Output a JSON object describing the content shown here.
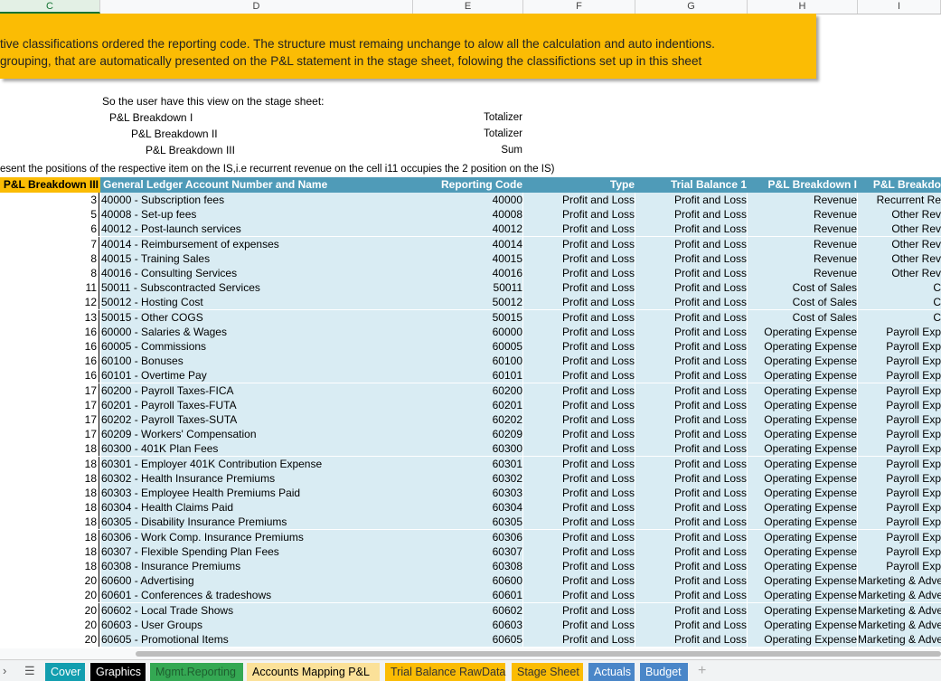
{
  "columns": [
    "C",
    "D",
    "E",
    "F",
    "G",
    "H",
    "I"
  ],
  "banner": {
    "line1": "tive classifications ordered the reporting code. The structure must remaing unchange to alow all the calculation and auto indentions.",
    "line2": " grouping, that are automatically presented on the P&L statement in the stage sheet, folowing the  classifictions set up in this sheet"
  },
  "notes": {
    "intro": "So the user have this view on the stage sheet:",
    "level1": "P&L Breakdown I",
    "level2": "P&L Breakdown II",
    "level3": "P&L Breakdown III",
    "level1_kind": "Totalizer",
    "level2_kind": "Totalizer",
    "level3_kind": "Sum",
    "positions": "esent the positions of the respective item on the IS,i.e recurrent revenue on the cell i11 occupies the 2 position on the IS)"
  },
  "table": {
    "headers": {
      "breakdown3": "P&L Breakdown III",
      "gl": "General Ledger Account Number and Name",
      "reporting_code": "Reporting Code",
      "type": "Type",
      "tb1": "Trial Balance 1",
      "b1": "P&L Breakdown I",
      "b2": "P&L Breakdo"
    },
    "rows": [
      [
        "3",
        "40000 - Subscription fees",
        "40000",
        "Profit and Loss",
        "Profit and Loss",
        "Revenue",
        "Recurrent Re"
      ],
      [
        "5",
        "40008 - Set-up fees",
        "40008",
        "Profit and Loss",
        "Profit and Loss",
        "Revenue",
        "Other Rev"
      ],
      [
        "6",
        "40012 - Post-launch services",
        "40012",
        "Profit and Loss",
        "Profit and Loss",
        "Revenue",
        "Other Rev"
      ],
      [
        "7",
        "40014 - Reimbursement of expenses",
        "40014",
        "Profit and Loss",
        "Profit and Loss",
        "Revenue",
        "Other Rev"
      ],
      [
        "8",
        "40015 - Training Sales",
        "40015",
        "Profit and Loss",
        "Profit and Loss",
        "Revenue",
        "Other Rev"
      ],
      [
        "8",
        "40016 - Consulting Services",
        "40016",
        "Profit and Loss",
        "Profit and Loss",
        "Revenue",
        "Other Rev"
      ],
      [
        "11",
        "50011 - Subscontracted Services",
        "50011",
        "Profit and Loss",
        "Profit and Loss",
        "Cost of Sales",
        "C"
      ],
      [
        "12",
        "50012 - Hosting Cost",
        "50012",
        "Profit and Loss",
        "Profit and Loss",
        "Cost of Sales",
        "C"
      ],
      [
        "13",
        "50015 - Other COGS",
        "50015",
        "Profit and Loss",
        "Profit and Loss",
        "Cost of Sales",
        "C"
      ],
      [
        "16",
        "60000 - Salaries & Wages",
        "60000",
        "Profit and Loss",
        "Profit and Loss",
        "Operating Expense",
        "Payroll Exp"
      ],
      [
        "16",
        "60005 - Commissions",
        "60005",
        "Profit and Loss",
        "Profit and Loss",
        "Operating Expense",
        "Payroll Exp"
      ],
      [
        "16",
        "60100 - Bonuses",
        "60100",
        "Profit and Loss",
        "Profit and Loss",
        "Operating Expense",
        "Payroll Exp"
      ],
      [
        "16",
        "60101 - Overtime Pay",
        "60101",
        "Profit and Loss",
        "Profit and Loss",
        "Operating Expense",
        "Payroll Exp"
      ],
      [
        "17",
        "60200 - Payroll Taxes-FICA",
        "60200",
        "Profit and Loss",
        "Profit and Loss",
        "Operating Expense",
        "Payroll Exp"
      ],
      [
        "17",
        "60201 - Payroll Taxes-FUTA",
        "60201",
        "Profit and Loss",
        "Profit and Loss",
        "Operating Expense",
        "Payroll Exp"
      ],
      [
        "17",
        "60202 - Payroll Taxes-SUTA",
        "60202",
        "Profit and Loss",
        "Profit and Loss",
        "Operating Expense",
        "Payroll Exp"
      ],
      [
        "17",
        "60209 - Workers' Compensation",
        "60209",
        "Profit and Loss",
        "Profit and Loss",
        "Operating Expense",
        "Payroll Exp"
      ],
      [
        "18",
        "60300 - 401K Plan Fees",
        "60300",
        "Profit and Loss",
        "Profit and Loss",
        "Operating Expense",
        "Payroll Exp"
      ],
      [
        "18",
        "60301 - Employer 401K Contribution Expense",
        "60301",
        "Profit and Loss",
        "Profit and Loss",
        "Operating Expense",
        "Payroll Exp"
      ],
      [
        "18",
        "60302 - Health Insurance Premiums",
        "60302",
        "Profit and Loss",
        "Profit and Loss",
        "Operating Expense",
        "Payroll Exp"
      ],
      [
        "18",
        "60303 - Employee Health Premiums Paid",
        "60303",
        "Profit and Loss",
        "Profit and Loss",
        "Operating Expense",
        "Payroll Exp"
      ],
      [
        "18",
        "60304 - Health Claims Paid",
        "60304",
        "Profit and Loss",
        "Profit and Loss",
        "Operating Expense",
        "Payroll Exp"
      ],
      [
        "18",
        "60305 - Disability Insurance Premiums",
        "60305",
        "Profit and Loss",
        "Profit and Loss",
        "Operating Expense",
        "Payroll Exp"
      ],
      [
        "18",
        "60306 - Work Comp. Insurance Premiums",
        "60306",
        "Profit and Loss",
        "Profit and Loss",
        "Operating Expense",
        "Payroll Exp"
      ],
      [
        "18",
        "60307 - Flexible Spending Plan Fees",
        "60307",
        "Profit and Loss",
        "Profit and Loss",
        "Operating Expense",
        "Payroll Exp"
      ],
      [
        "18",
        "60308 - Insurance Premiums",
        "60308",
        "Profit and Loss",
        "Profit and Loss",
        "Operating Expense",
        "Payroll Exp"
      ],
      [
        "20",
        "60600 - Advertising",
        "60600",
        "Profit and Loss",
        "Profit and Loss",
        "Operating Expense",
        "Marketing & Adve"
      ],
      [
        "20",
        "60601 - Conferences & tradeshows",
        "60601",
        "Profit and Loss",
        "Profit and Loss",
        "Operating Expense",
        "Marketing & Adve"
      ],
      [
        "20",
        "60602 - Local Trade Shows",
        "60602",
        "Profit and Loss",
        "Profit and Loss",
        "Operating Expense",
        "Marketing & Adve"
      ],
      [
        "20",
        "60603 - User Groups",
        "60603",
        "Profit and Loss",
        "Profit and Loss",
        "Operating Expense",
        "Marketing & Adve"
      ],
      [
        "20",
        "60605 - Promotional Items",
        "60605",
        "Profit and Loss",
        "Profit and Loss",
        "Operating Expense",
        "Marketing & Adve"
      ]
    ]
  },
  "sheet_tabs": [
    {
      "label": "Cover",
      "bg": "#129eaf",
      "fg": "#ffffff"
    },
    {
      "label": "Graphics",
      "bg": "#000000",
      "fg": "#ffffff"
    },
    {
      "label": "Mgmt.Reporting",
      "bg": "#34a853",
      "fg": "#1e5e2f"
    },
    {
      "label": "Accounts Mapping P&L",
      "bg": "#fbe199",
      "fg": "#000000"
    },
    {
      "label": "Trial Balance RawData",
      "bg": "#fbbc04",
      "fg": "#333333"
    },
    {
      "label": "Stage Sheet",
      "bg": "#fbbc04",
      "fg": "#333333"
    },
    {
      "label": "Actuals",
      "bg": "#4a86c8",
      "fg": "#ffffff"
    },
    {
      "label": "Budget",
      "bg": "#4a86c8",
      "fg": "#ffffff"
    }
  ],
  "icons": {
    "nav": "chevron-right-icon",
    "menu": "menu-icon",
    "add": "plus-icon"
  }
}
